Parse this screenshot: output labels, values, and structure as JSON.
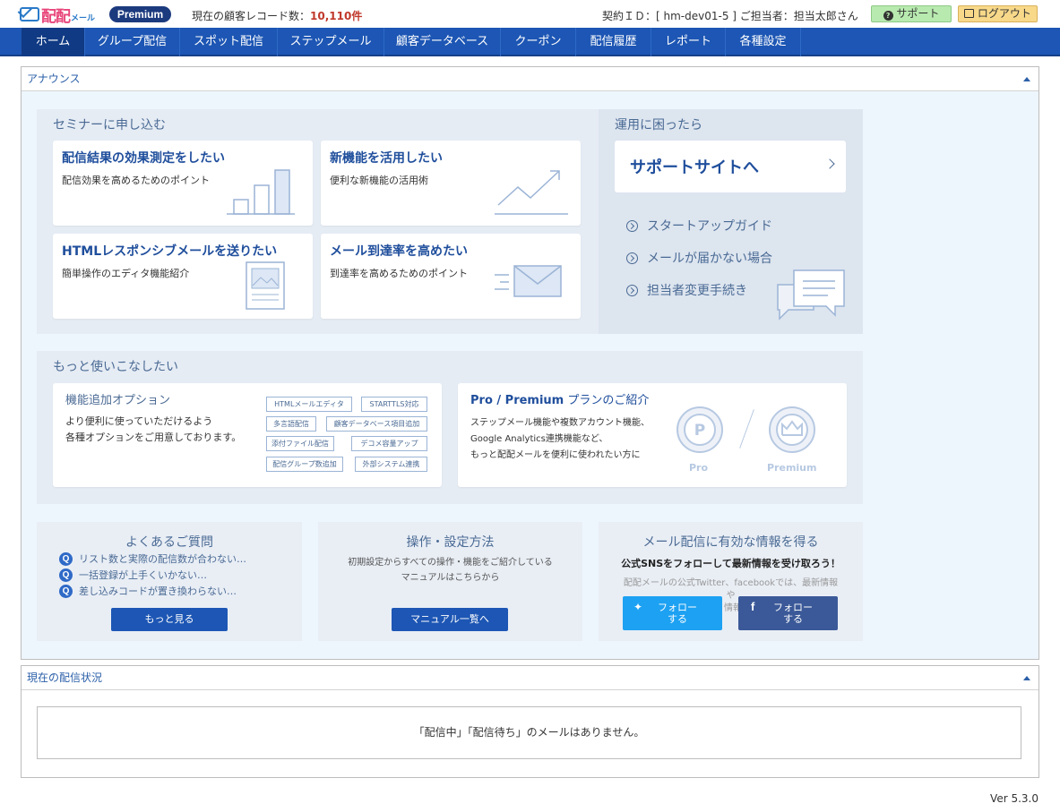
{
  "header": {
    "logo_text": "配配",
    "logo_sub": "メール",
    "plan_badge": "Premium",
    "record_label": "現在の顧客レコード数：",
    "record_count": "10,110件",
    "contract_info": "契約ＩＤ：[ hm-dev01-5 ]  ご担当者：担当太郎さん",
    "support_label": "サポート",
    "logout_label": "ログアウト"
  },
  "nav": {
    "items": [
      {
        "label": "ホーム"
      },
      {
        "label": "グループ配信"
      },
      {
        "label": "スポット配信"
      },
      {
        "label": "ステップメール"
      },
      {
        "label": "顧客データベース"
      },
      {
        "label": "クーポン"
      },
      {
        "label": "配信履歴"
      },
      {
        "label": "レポート"
      },
      {
        "label": "各種設定"
      }
    ]
  },
  "announce": {
    "title": "アナウンス",
    "seminar": {
      "title": "セミナーに申し込む",
      "cards": [
        {
          "title": "配信結果の効果測定をしたい",
          "desc": "配信効果を高めるためのポイント",
          "icon": "bar-chart-icon"
        },
        {
          "title": "新機能を活用したい",
          "desc": "便利な新機能の活用術",
          "icon": "trend-up-icon"
        },
        {
          "title": "HTMLレスポンシブメールを送りたい",
          "desc": "簡単操作のエディタ機能紹介",
          "icon": "document-image-icon"
        },
        {
          "title": "メール到達率を高めたい",
          "desc": "到達率を高めるためのポイント",
          "icon": "envelope-icon"
        }
      ]
    },
    "support": {
      "title": "運用に困ったら",
      "site_button": "サポートサイトへ",
      "links": [
        "スタートアップガイド",
        "メールが届かない場合",
        "担当者変更手続き"
      ]
    },
    "more": {
      "title": "もっと使いこなしたい",
      "options": {
        "title": "機能追加オプション",
        "desc1": "より便利に使っていただけるよう",
        "desc2": "各種オプションをご用意しております。",
        "tags": [
          "HTMLメールエディタ",
          "STARTTLS対応",
          "多言語配信",
          "顧客データベース項目追加",
          "添付ファイル配信",
          "デコメ容量アップ",
          "配信グループ数追加",
          "外部システム連携"
        ]
      },
      "plan": {
        "title_bold": "Pro / Premium",
        "title_rest": " プランのご紹介",
        "desc1": "ステップメール機能や複数アカウント機能、",
        "desc2": "Google Analytics連携機能など、",
        "desc3": "もっと配配メールを便利に使われたい方に",
        "pro_label": "Pro",
        "premium_label": "Premium",
        "pro_letter": "P"
      }
    },
    "faq": {
      "title": "よくあるご質問",
      "q_mark": "Q",
      "items": [
        "リスト数と実際の配信数が合わない…",
        "一括登録が上手くいかない…",
        "差し込みコードが置き換わらない…"
      ],
      "button": "もっと見る"
    },
    "manual": {
      "title": "操作・設定方法",
      "desc1": "初期設定からすべての操作・機能をご紹介している",
      "desc2": "マニュアルはこちらから",
      "button": "マニュアル一覧へ"
    },
    "sns": {
      "title": "メール配信に有効な情報を得る",
      "headline": "公式SNSをフォローして最新情報を受け取ろう！",
      "desc1": "配配メールの公式Twitter、facebookでは、最新情報",
      "desc2": "や",
      "desc3": "情報",
      "twitter_button": "フォローする",
      "facebook_button": "フォローする"
    }
  },
  "status_panel": {
    "title": "現在の配信状況",
    "message": "「配信中」「配信待ち」のメールはありません。"
  },
  "footer": {
    "version": "Ver 5.3.0"
  },
  "colors": {
    "nav_bg": "#1d56b4",
    "nav_active": "#103a84",
    "accent_blue": "#1f4e9c",
    "record_red": "#c0392b",
    "twitter": "#1da1f2",
    "facebook": "#3b5998"
  }
}
